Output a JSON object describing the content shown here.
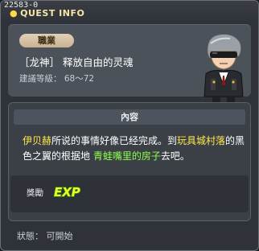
{
  "window": {
    "quest_id": "22583-0",
    "title": "QUEST INFO"
  },
  "header": {
    "job_tag": "職業",
    "quest_name": "［龙神］ 释放自由的灵魂",
    "recommended_level": "建議等級： 68～72"
  },
  "content": {
    "section_title": "內容",
    "text": {
      "npc": "伊贝赫",
      "part1": "所说的事情好像已经完成。到",
      "location": "玩具城村落",
      "part2": "的黑色之翼的根据地 ",
      "place": "青蛙嘴里的房子",
      "part3": "去吧。"
    }
  },
  "reward": {
    "label": "獎勵",
    "icon": "exp-icon",
    "icon_text": "EXP"
  },
  "status": {
    "text": "狀態： 可開始"
  },
  "colors": {
    "highlight_yellow": "#ffe84d",
    "highlight_green": "#8dff4a",
    "title_accent": "#ffd84a"
  }
}
